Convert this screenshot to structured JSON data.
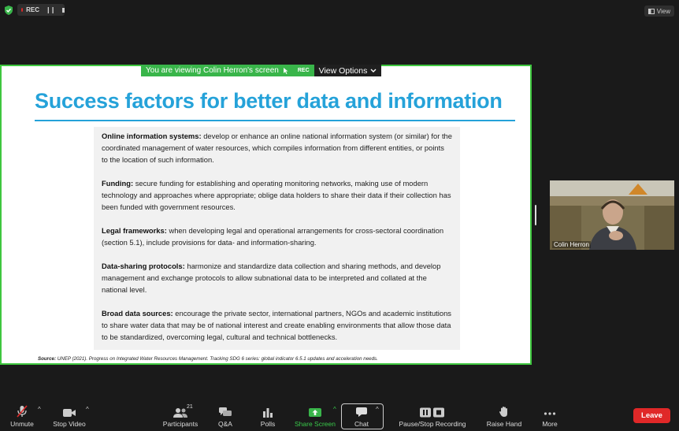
{
  "top": {
    "rec_label": "REC",
    "view_label": "View"
  },
  "banner": {
    "viewing_text": "You are viewing Colin Herron's screen",
    "rec_label": "REC",
    "view_options": "View Options"
  },
  "slide": {
    "title": "Success factors for better data and information",
    "items": [
      {
        "heading": "Online information systems:",
        "text": " develop or enhance an online national information system (or similar) for the coordinated management of water resources, which compiles information from different entities, or points to the location of such information."
      },
      {
        "heading": "Funding:",
        "text": " secure funding for establishing and operating monitoring networks, making use of modern technology and approaches where appropriate; oblige data holders to share their data if their collection has been funded with government resources."
      },
      {
        "heading": "Legal frameworks:",
        "text": " when developing legal and operational arrangements for cross-sectoral coordination (section 5.1), include provisions for data- and information-sharing."
      },
      {
        "heading": "Data-sharing protocols:",
        "text": " harmonize and standardize data collection and sharing methods, and develop management and exchange protocols to allow subnational data to be interpreted and collated at the national level."
      },
      {
        "heading": "Broad data sources:",
        "text": " encourage the private sector, international partners, NGOs and academic institutions to share water data that may be of national interest and create enabling environments that allow those data to be standardized, overcoming legal, cultural and technical bottlenecks."
      }
    ],
    "source_label": "Source:",
    "source_text": " UNEP (2021). Progress on Integrated Water Resources Management. Tracking SDG 6 series: global indicator 6.5.1 updates and acceleration needs."
  },
  "participant": {
    "name": "Colin Herron"
  },
  "toolbar": {
    "unmute": "Unmute",
    "stop_video": "Stop Video",
    "participants": "Participants",
    "participants_count": "21",
    "qa": "Q&A",
    "polls": "Polls",
    "share_screen": "Share Screen",
    "chat": "Chat",
    "pause_stop_recording": "Pause/Stop Recording",
    "raise_hand": "Raise Hand",
    "more": "More",
    "leave": "Leave"
  },
  "colors": {
    "title_blue": "#25a2d9",
    "share_border_green": "#3ec63e",
    "leave_red": "#e02828"
  }
}
